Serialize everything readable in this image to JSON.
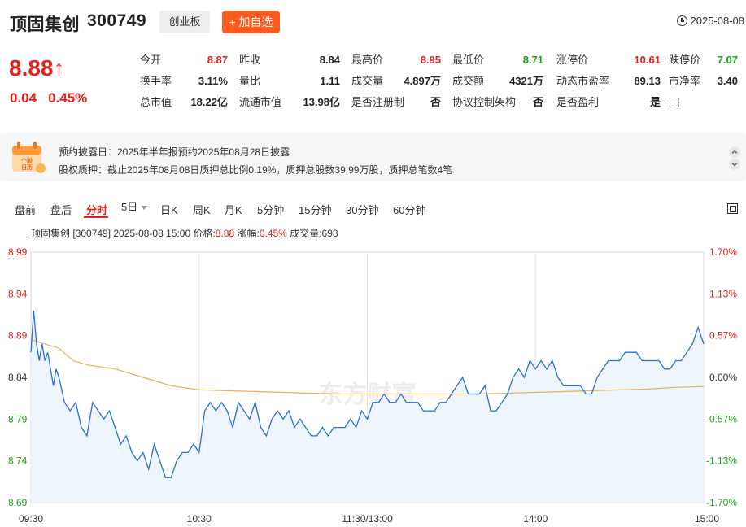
{
  "header": {
    "name": "顶固集创",
    "code": "300749",
    "board": "创业板",
    "add_label": "+ 加自选",
    "date": "2025-08-08"
  },
  "quote": {
    "price": "8.88↑",
    "change": "0.04",
    "change_pct": "0.45%",
    "rows": [
      [
        {
          "k": "今开",
          "v": "8.87",
          "c": "red"
        },
        {
          "k": "昨收",
          "v": "8.84",
          "c": ""
        },
        {
          "k": "最高价",
          "v": "8.95",
          "c": "red"
        },
        {
          "k": "最低价",
          "v": "8.71",
          "c": "green"
        },
        {
          "k": "涨停价",
          "v": "10.61",
          "c": "red"
        },
        {
          "k": "跌停价",
          "v": "7.07",
          "c": "green"
        }
      ],
      [
        {
          "k": "换手率",
          "v": "3.11%",
          "c": ""
        },
        {
          "k": "量比",
          "v": "1.11",
          "c": ""
        },
        {
          "k": "成交量",
          "v": "4.897万",
          "c": ""
        },
        {
          "k": "成交额",
          "v": "4321万",
          "c": ""
        },
        {
          "k": "动态市盈率",
          "v": "89.13",
          "c": ""
        },
        {
          "k": "市净率",
          "v": "3.40",
          "c": ""
        }
      ],
      [
        {
          "k": "总市值",
          "v": "18.22亿",
          "c": ""
        },
        {
          "k": "流通市值",
          "v": "13.98亿",
          "c": ""
        },
        {
          "k": "是否注册制",
          "v": "否",
          "c": ""
        },
        {
          "k": "协议控制架构",
          "v": "否",
          "c": ""
        },
        {
          "k": "是否盈利",
          "v": "是",
          "c": ""
        }
      ]
    ]
  },
  "notice": {
    "icon_label": "个股日历",
    "line1": "预约披露日：2025年半年报预约2025年08月28日披露",
    "line2": "股权质押：截止2025年08月08日质押总比例0.19%，质押总股数39.99万股，质押总笔数4笔"
  },
  "tabs": [
    "盘前",
    "盘后",
    "分时",
    "5日",
    "日K",
    "周K",
    "月K",
    "5分钟",
    "15分钟",
    "30分钟",
    "60分钟"
  ],
  "active_tab": "分时",
  "chart_info": {
    "prefix": "顶固集创 [300749]  2025-08-08 15:00  价格:",
    "price": "8.88",
    "mid": " 涨幅:",
    "pct": "0.45%",
    "suffix": " 成交量:698"
  },
  "watermark": "东方财富",
  "colors": {
    "up": "#e0231b",
    "down": "#18a418",
    "accent": "#ff5a1f",
    "price_line": "#2b6fd8",
    "avg_line": "#e3b35a"
  },
  "chart_data": {
    "type": "line",
    "title": "",
    "xlabel": "",
    "ylabel": "",
    "ylim": [
      8.69,
      8.99
    ],
    "prev_close": 8.84,
    "y_ticks_left": [
      "8.99",
      "8.94",
      "8.89",
      "8.84",
      "8.79",
      "8.74",
      "8.69"
    ],
    "y_ticks_right": [
      "1.70%",
      "1.13%",
      "0.57%",
      "0.00%",
      "-0.57%",
      "-1.13%",
      "-1.70%"
    ],
    "x_ticks": [
      "09:30",
      "10:30",
      "11:30/13:00",
      "14:00",
      "15:00"
    ],
    "total_minutes": 240,
    "series": [
      {
        "key": "price",
        "minutes": [
          0,
          1,
          2,
          3,
          4,
          5,
          6,
          7,
          8,
          9,
          10,
          12,
          14,
          16,
          18,
          20,
          22,
          24,
          26,
          28,
          30,
          32,
          34,
          36,
          38,
          40,
          42,
          44,
          46,
          48,
          50,
          52,
          54,
          56,
          58,
          60,
          62,
          64,
          66,
          68,
          70,
          72,
          74,
          76,
          78,
          80,
          82,
          84,
          86,
          88,
          90,
          92,
          94,
          96,
          98,
          100,
          102,
          104,
          106,
          108,
          110,
          112,
          114,
          116,
          118,
          120,
          122,
          124,
          126,
          128,
          130,
          132,
          134,
          136,
          138,
          140,
          142,
          144,
          146,
          148,
          150,
          152,
          154,
          156,
          158,
          160,
          162,
          164,
          166,
          168,
          170,
          172,
          174,
          176,
          178,
          180,
          182,
          184,
          186,
          188,
          190,
          192,
          194,
          196,
          198,
          200,
          202,
          204,
          206,
          208,
          210,
          212,
          214,
          216,
          218,
          220,
          222,
          224,
          226,
          228,
          230,
          232,
          234,
          236,
          238,
          240
        ],
        "values": [
          8.87,
          8.92,
          8.88,
          8.86,
          8.88,
          8.86,
          8.87,
          8.85,
          8.83,
          8.85,
          8.84,
          8.81,
          8.8,
          8.81,
          8.78,
          8.77,
          8.81,
          8.8,
          8.79,
          8.8,
          8.78,
          8.76,
          8.77,
          8.75,
          8.74,
          8.75,
          8.73,
          8.76,
          8.74,
          8.72,
          8.72,
          8.74,
          8.75,
          8.75,
          8.76,
          8.75,
          8.8,
          8.81,
          8.8,
          8.81,
          8.8,
          8.78,
          8.81,
          8.8,
          8.79,
          8.81,
          8.78,
          8.77,
          8.79,
          8.8,
          8.79,
          8.8,
          8.78,
          8.79,
          8.78,
          8.77,
          8.77,
          8.78,
          8.77,
          8.78,
          8.78,
          8.78,
          8.79,
          8.78,
          8.8,
          8.79,
          8.81,
          8.81,
          8.82,
          8.81,
          8.81,
          8.82,
          8.81,
          8.81,
          8.81,
          8.8,
          8.8,
          8.8,
          8.81,
          8.81,
          8.82,
          8.83,
          8.84,
          8.82,
          8.82,
          8.82,
          8.83,
          8.8,
          8.8,
          8.81,
          8.82,
          8.84,
          8.85,
          8.84,
          8.86,
          8.85,
          8.86,
          8.85,
          8.86,
          8.84,
          8.83,
          8.83,
          8.83,
          8.83,
          8.82,
          8.82,
          8.84,
          8.85,
          8.86,
          8.86,
          8.86,
          8.87,
          8.87,
          8.87,
          8.86,
          8.86,
          8.86,
          8.86,
          8.85,
          8.85,
          8.86,
          8.86,
          8.87,
          8.88,
          8.9,
          8.88
        ]
      },
      {
        "key": "average",
        "minutes": [
          0,
          5,
          10,
          15,
          20,
          30,
          40,
          50,
          60,
          70,
          80,
          90,
          100,
          110,
          120,
          130,
          140,
          150,
          160,
          170,
          180,
          190,
          200,
          210,
          220,
          230,
          240
        ],
        "values": [
          8.885,
          8.88,
          8.875,
          8.86,
          8.855,
          8.85,
          8.84,
          8.83,
          8.825,
          8.824,
          8.823,
          8.822,
          8.821,
          8.82,
          8.82,
          8.82,
          8.82,
          8.82,
          8.82,
          8.821,
          8.822,
          8.823,
          8.824,
          8.825,
          8.826,
          8.828,
          8.829
        ]
      }
    ]
  }
}
